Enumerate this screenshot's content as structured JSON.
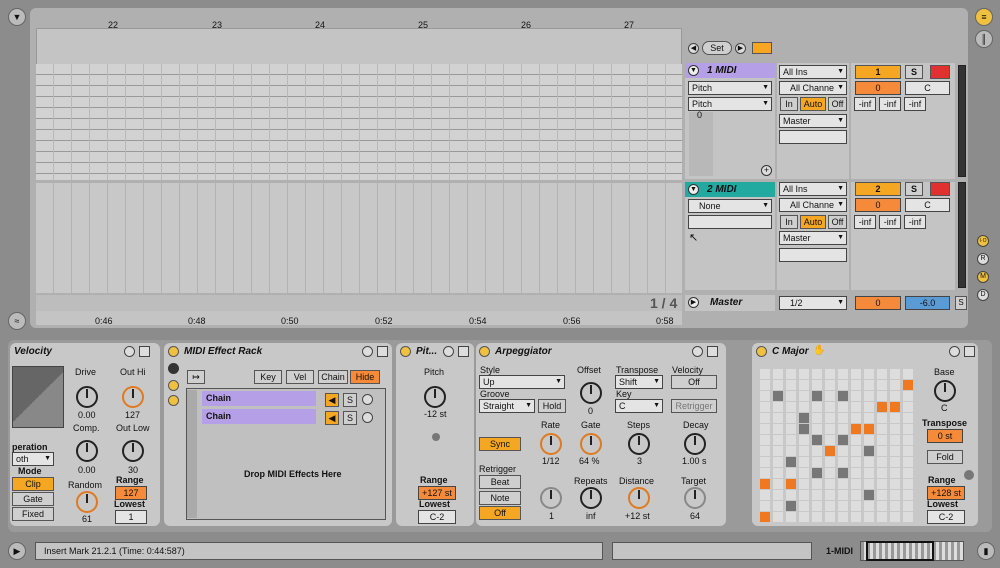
{
  "arrangement": {
    "bar_numbers": [
      "22",
      "23",
      "24",
      "25",
      "26",
      "27"
    ],
    "time_labels": [
      "0:46",
      "0:48",
      "0:50",
      "0:52",
      "0:54",
      "0:56",
      "0:58"
    ],
    "page_indicator": "1 / 4",
    "set_label": "Set"
  },
  "tracks": [
    {
      "name": "1 MIDI",
      "color": "#b5a0e8",
      "chooser1": "Pitch",
      "chooser2": "Pitch",
      "value0": "0",
      "input": "All Ins",
      "channel": "All Channe",
      "in": "In",
      "auto": "Auto",
      "off": "Off",
      "out": "Master",
      "number": "1",
      "vol": "0",
      "pan": "C",
      "solo": "S",
      "inf1": "-inf",
      "inf2": "-inf",
      "inf3": "-inf"
    },
    {
      "name": "2 MIDI",
      "color": "#22a9a0",
      "chooser1": "None",
      "input": "All Ins",
      "channel": "All Channe",
      "in": "In",
      "auto": "Auto",
      "off": "Off",
      "out": "Master",
      "number": "2",
      "vol": "0",
      "pan": "C",
      "solo": "S",
      "inf1": "-inf",
      "inf2": "-inf",
      "inf3": "-inf"
    }
  ],
  "master": {
    "name": "Master",
    "quant": "1/2",
    "vol": "0",
    "db": "-6.0",
    "solo": "S"
  },
  "io_buttons": [
    "I·O",
    "R",
    "M",
    "D"
  ],
  "velocity": {
    "title": "Velocity",
    "drive_label": "Drive",
    "drive_value": "0.00",
    "outhi_label": "Out Hi",
    "outhi_value": "127",
    "comp_label": "Comp.",
    "comp_value": "0.00",
    "outlow_label": "Out Low",
    "outlow_value": "30",
    "random_label": "Random",
    "random_value": "61",
    "range_label": "Range",
    "range_value": "127",
    "lowest_label": "Lowest",
    "lowest_value": "1",
    "operation_label": "peration",
    "operation_value": "oth",
    "mode_label": "Mode",
    "mode_clip": "Clip",
    "mode_gate": "Gate",
    "mode_fixed": "Fixed"
  },
  "rack": {
    "title": "MIDI Effect Rack",
    "key": "Key",
    "vel": "Vel",
    "chain_btn": "Chain",
    "hide": "Hide",
    "chains": [
      "Chain",
      "Chain"
    ],
    "drop_text": "Drop MIDI Effects Here",
    "chain_solo": "S"
  },
  "pitch": {
    "title": "Pit...",
    "pitch_label": "Pitch",
    "pitch_value": "-12 st",
    "range_label": "Range",
    "range_value": "+127 st",
    "lowest_label": "Lowest",
    "lowest_value": "C-2"
  },
  "arp": {
    "title": "Arpeggiator",
    "style_label": "Style",
    "style_value": "Up",
    "groove_label": "Groove",
    "groove_value": "Straight",
    "hold": "Hold",
    "offset_label": "Offset",
    "offset_value": "0",
    "transpose_label": "Transpose",
    "transpose_value": "Shift",
    "key_label": "Key",
    "key_value": "C",
    "velocity_label": "Velocity",
    "velocity_value": "Off",
    "retrigger_btn": "Retrigger",
    "sync": "Sync",
    "rate_label": "Rate",
    "rate_value": "1/12",
    "gate_label": "Gate",
    "gate_value": "64 %",
    "steps_label": "Steps",
    "steps_value": "3",
    "decay_label": "Decay",
    "decay_value": "1.00 s",
    "retrigger_label": "Retrigger",
    "beat": "Beat",
    "note": "Note",
    "off": "Off",
    "repeats_label": "Repeats",
    "repeats_value": "inf",
    "repeats_knob_value": "1",
    "distance_label": "Distance",
    "distance_value": "+12 st",
    "target_label": "Target",
    "target_value": "64"
  },
  "scale": {
    "title": "C Major",
    "base_label": "Base",
    "base_value": "C",
    "transpose_label": "Transpose",
    "transpose_value": "0 st",
    "fold": "Fold",
    "range_label": "Range",
    "range_value": "+128 st",
    "lowest_label": "Lowest",
    "lowest_value": "C-2"
  },
  "status": {
    "text": "Insert Mark 21.2.1 (Time: 0:44:587)",
    "track": "1-MIDI"
  }
}
